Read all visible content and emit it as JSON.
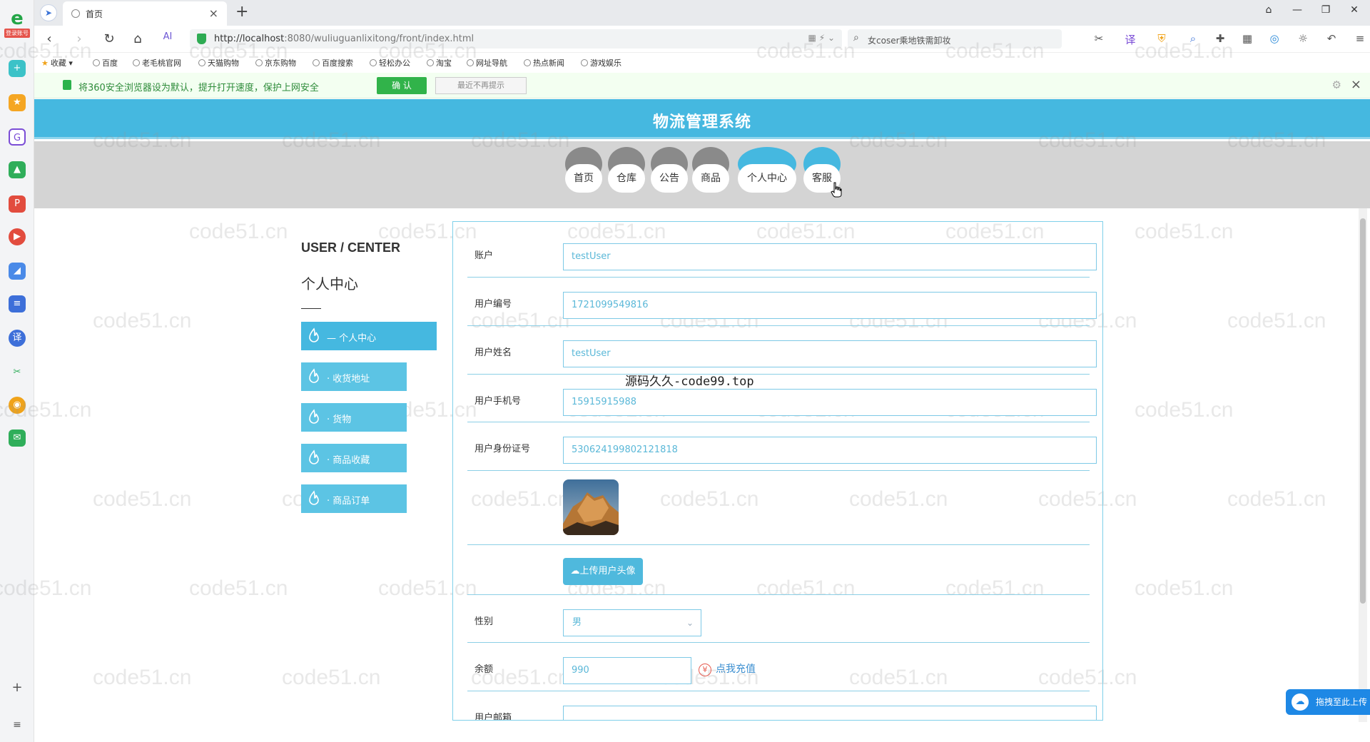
{
  "browser": {
    "tab_title": "首页",
    "url": "http://localhost:8080/wuliuguanlixitong/front/index.html",
    "url_host": "http://localhost",
    "url_rest": ":8080/wuliuguanlixitong/front/index.html",
    "search_text": "女coser乘地铁需卸妆",
    "sidebar_tag": "登录账号",
    "bookmarks": [
      "收藏",
      "百度",
      "老毛桃官网",
      "天猫购物",
      "京东购物",
      "百度搜索",
      "轻松办公",
      "淘宝",
      "网址导航",
      "热点新闻",
      "游戏娱乐"
    ],
    "notice": {
      "message": "将360安全浏览器设为默认，提升打开速度，保护上网安全",
      "confirm": "确 认",
      "dismiss": "最近不再提示"
    }
  },
  "site": {
    "title": "物流管理系统",
    "nav": [
      "首页",
      "仓库",
      "公告",
      "商品",
      "个人中心",
      "客服"
    ]
  },
  "user_center": {
    "title_en": "USER / CENTER",
    "title_cn": "个人中心",
    "menu": [
      "— 个人中心",
      "· 收货地址",
      "· 货物",
      "· 商品收藏",
      "· 商品订单"
    ]
  },
  "form": {
    "account_label": "账户",
    "account_value": "testUser",
    "userno_label": "用户编号",
    "userno_value": "1721099549816",
    "name_label": "用户姓名",
    "name_value": "testUser",
    "phone_label": "用户手机号",
    "phone_value": "15915915988",
    "idcard_label": "用户身份证号",
    "idcard_value": "530624199802121818",
    "upload_label": "上传用户头像",
    "gender_label": "性别",
    "gender_value": "男",
    "balance_label": "余额",
    "balance_value": "990",
    "recharge_label": "点我充值",
    "email_label": "用户邮箱"
  },
  "overlay_text": "源码久久-code99.top",
  "watermark": "code51.cn",
  "drag_upload": "拖拽至此上传"
}
